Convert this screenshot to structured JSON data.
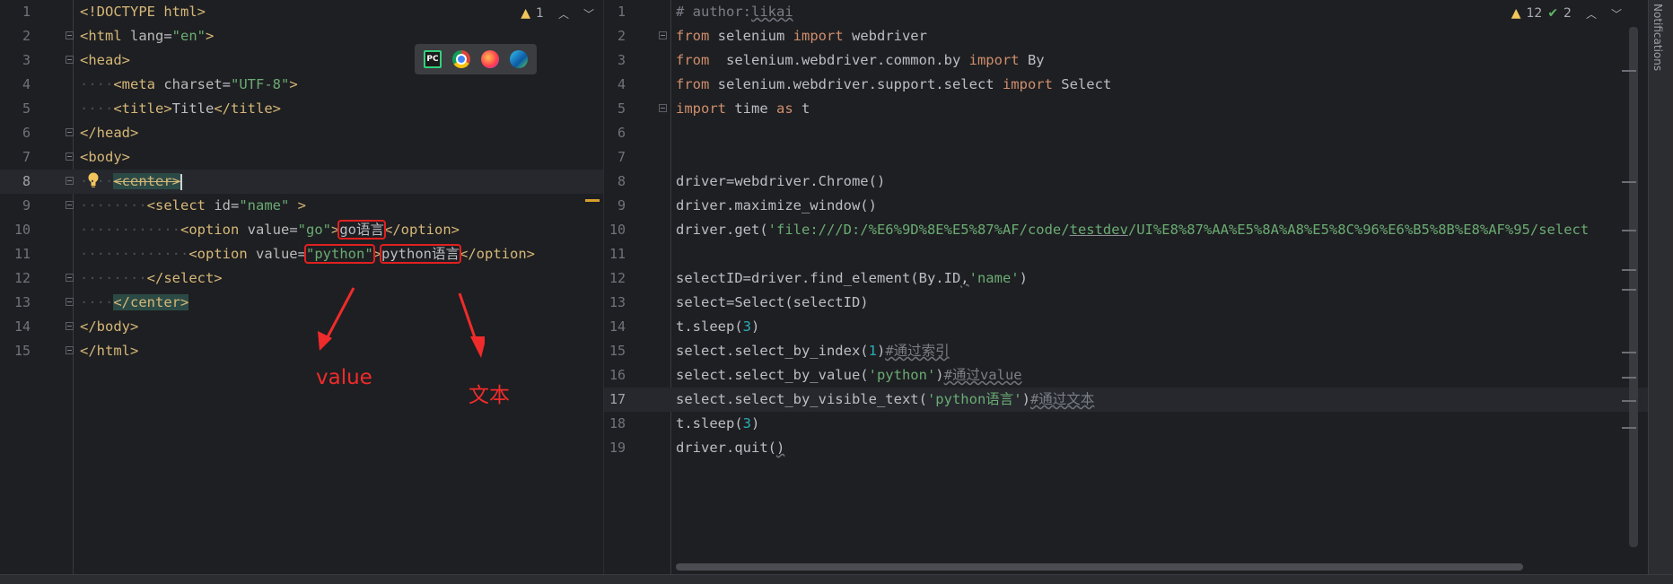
{
  "left_editor": {
    "status": {
      "warnings": "1"
    },
    "lines": [
      {
        "n": "1"
      },
      {
        "n": "2"
      },
      {
        "n": "3"
      },
      {
        "n": "4"
      },
      {
        "n": "5"
      },
      {
        "n": "6"
      },
      {
        "n": "7"
      },
      {
        "n": "8"
      },
      {
        "n": "9"
      },
      {
        "n": "10"
      },
      {
        "n": "11"
      },
      {
        "n": "12"
      },
      {
        "n": "13"
      },
      {
        "n": "14"
      },
      {
        "n": "15"
      }
    ],
    "code": {
      "l1": "<!DOCTYPE html>",
      "l2a": "<html ",
      "l2b": "lang",
      "l2c": "=",
      "l2d": "\"en\"",
      "l2e": ">",
      "l3": "<head>",
      "l4a": "<meta ",
      "l4b": "charset",
      "l4c": "=",
      "l4d": "\"UTF-8\"",
      "l4e": ">",
      "l5a": "<title>",
      "l5b": "Title",
      "l5c": "</title>",
      "l6": "</head>",
      "l7": "<body>",
      "l8": "<center>",
      "l9a": "<select ",
      "l9b": "id",
      "l9c": "=",
      "l9d": "\"name\"",
      "l9e": " >",
      "l10a": "<option ",
      "l10b": "value",
      "l10c": "=",
      "l10d": "\"go\"",
      "l10e": ">",
      "l10f": "go语言",
      "l10g": "</option>",
      "l11a": "<option ",
      "l11b": "value",
      "l11c": "=",
      "l11d": "\"python\"",
      "l11e": ">",
      "l11f": "python语言",
      "l11g": "</option>",
      "l12": "</select>",
      "l13": "</center>",
      "l14": "</body>",
      "l15": "</html>"
    },
    "annotations": {
      "value_label": "value",
      "text_label": "文本"
    }
  },
  "browser_icons": [
    "pycharm-icon",
    "chrome-icon",
    "firefox-icon",
    "edge-icon"
  ],
  "right_editor": {
    "status": {
      "warnings": "12",
      "weak_warnings": "2"
    },
    "lines": [
      {
        "n": "1"
      },
      {
        "n": "2"
      },
      {
        "n": "3"
      },
      {
        "n": "4"
      },
      {
        "n": "5"
      },
      {
        "n": "6"
      },
      {
        "n": "7"
      },
      {
        "n": "8"
      },
      {
        "n": "9"
      },
      {
        "n": "10"
      },
      {
        "n": "11"
      },
      {
        "n": "12"
      },
      {
        "n": "13"
      },
      {
        "n": "14"
      },
      {
        "n": "15"
      },
      {
        "n": "16"
      },
      {
        "n": "17"
      },
      {
        "n": "18"
      },
      {
        "n": "19"
      }
    ],
    "code": {
      "l1a": "# author:",
      "l1b": "likai",
      "l2a": "from",
      "l2b": " selenium ",
      "l2c": "import",
      "l2d": " webdriver",
      "l3a": "from",
      "l3b": "  selenium.webdriver.common.by ",
      "l3c": "import",
      "l3d": " By",
      "l4a": "from",
      "l4b": " selenium.webdriver.support.select ",
      "l4c": "import",
      "l4d": " Select",
      "l5a": "import",
      "l5b": " time ",
      "l5c": "as",
      "l5d": " t",
      "l8": "driver=webdriver.Chrome()",
      "l9": "driver.maximize_window()",
      "l10a": "driver.get(",
      "l10b": "'file:///D:/%E6%9D%8E%E5%87%AF/code/",
      "l10c": "testdev",
      "l10d": "/UI%E8%87%AA%E5%8A%A8%E5%8C%96%E6%B5%8B%E8%AF%95/select",
      "l12a": "selectID=driver.find_element(By.ID",
      "l12b": ",",
      "l12c": "'name'",
      "l12d": ")",
      "l13": "select=Select(selectID)",
      "l14a": "t.sleep(",
      "l14b": "3",
      "l14c": ")",
      "l15a": "select.select_by_index(",
      "l15b": "1",
      "l15c": ")",
      "l15d": "#通过索引",
      "l16a": "select.select_by_value(",
      "l16b": "'python'",
      "l16c": ")",
      "l16d": "#通过value",
      "l17a": "select.select_by_visible_text(",
      "l17b": "'python语言'",
      "l17c": ")",
      "l17d": "#通过文本",
      "l18a": "t.sleep(",
      "l18b": "3",
      "l18c": ")",
      "l19a": "driver.quit(",
      "l19b": ")"
    }
  },
  "side_panel": {
    "notifications_label": "Notifications"
  }
}
